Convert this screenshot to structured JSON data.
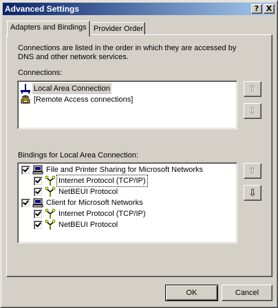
{
  "window": {
    "title": "Advanced Settings"
  },
  "titlebar_buttons": {
    "help": "?",
    "close": "X"
  },
  "tabs": [
    {
      "label": "Adapters and Bindings",
      "active": true
    },
    {
      "label": "Provider Order",
      "active": false
    }
  ],
  "description": "Connections are listed in the order in which they are accessed by DNS and other network services.",
  "connections": {
    "label": "Connections:",
    "items": [
      {
        "label": "Local Area Connection",
        "icon": "network-adapter-icon",
        "selected": true
      },
      {
        "label": "[Remote Access connections]",
        "icon": "phone-modem-icon",
        "selected": false
      }
    ],
    "up_glyph": "⇧",
    "down_glyph": "⇩"
  },
  "bindings": {
    "label": "Bindings for Local Area Connection:",
    "items": [
      {
        "label": "File and Printer Sharing for Microsoft Networks",
        "checked": true,
        "level": 0,
        "icon": "computer-icon"
      },
      {
        "label": "Internet Protocol (TCP/IP)",
        "checked": true,
        "level": 1,
        "icon": "protocol-icon",
        "selected": true
      },
      {
        "label": "NetBEUI Protocol",
        "checked": true,
        "level": 1,
        "icon": "protocol-icon"
      },
      {
        "label": "Client for Microsoft Networks",
        "checked": true,
        "level": 0,
        "icon": "computer-icon"
      },
      {
        "label": "Internet Protocol (TCP/IP)",
        "checked": true,
        "level": 1,
        "icon": "protocol-icon"
      },
      {
        "label": "NetBEUI Protocol",
        "checked": true,
        "level": 1,
        "icon": "protocol-icon"
      }
    ],
    "up_glyph": "⇧",
    "down_glyph": "⇩"
  },
  "buttons": {
    "ok": "OK",
    "cancel": "Cancel"
  },
  "colors": {
    "title_start": "#0a246a",
    "title_end": "#a6caf0",
    "face": "#d4d0c8",
    "selection_gray": "#d4d0c8"
  }
}
